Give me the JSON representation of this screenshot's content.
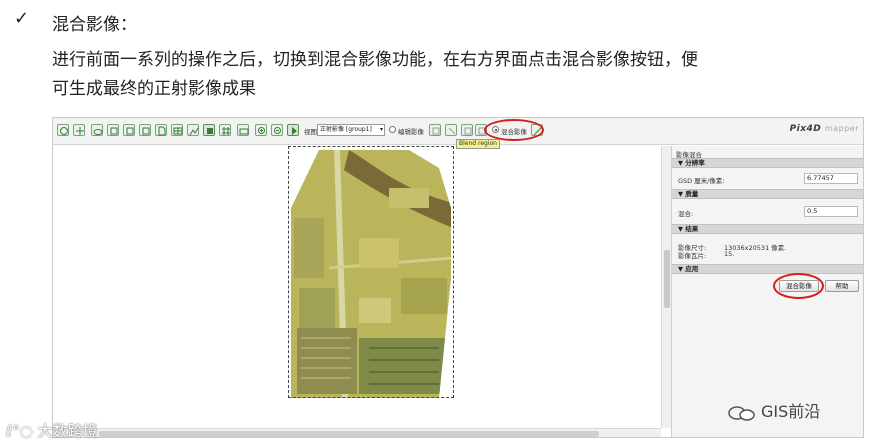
{
  "doc": {
    "check_mark": "✓",
    "heading": "混合影像：",
    "paragraph_line1": "进行前面一系列的操作之后，切换到混合影像功能，在右方界面点击混合影像按钮，便",
    "paragraph_line2": "可生成最终的正射影像成果"
  },
  "toolbar": {
    "view_label": "视图:",
    "view_select_value": "正射影像 [group1]",
    "edit_image_label": "编辑影像",
    "blend_image_label": "混合影像",
    "icons": [
      "layers-icon",
      "crosshair-icon",
      "cloud-icon",
      "frame-icon",
      "frame-icon",
      "frame-icon",
      "document-icon",
      "table-icon",
      "chart-icon",
      "tile-icon",
      "grid-icon",
      "camera-icon",
      "zoom-in-icon",
      "zoom-out-icon",
      "pointer-icon"
    ]
  },
  "logo": {
    "brand": "Pix4D",
    "suffix": "mapper"
  },
  "canvas": {
    "blend_region_tag": "Blend region"
  },
  "panel": {
    "title": "影像混合",
    "sections": {
      "resolution": "分辨率",
      "quality": "质量",
      "result": "结果",
      "apply": "应用"
    },
    "gsd_label": "GSD 厘米/像素:",
    "gsd_value": "6.77457",
    "blend_label": "混合:",
    "blend_value": "0.5",
    "image_size_label": "影像尺寸:",
    "image_size_value": "13036x20531 像素.",
    "tile_count_label": "影像瓦片:",
    "tile_count_value": "15.",
    "blend_button": "混合影像",
    "help_button": "帮助"
  },
  "watermarks": {
    "left": "大数跨境",
    "right": "GIS前沿"
  },
  "colors": {
    "highlight_ring": "#d21e1e",
    "blend_tag_bg": "#f2ef8f",
    "ortho_tint": "#b9b25a"
  }
}
